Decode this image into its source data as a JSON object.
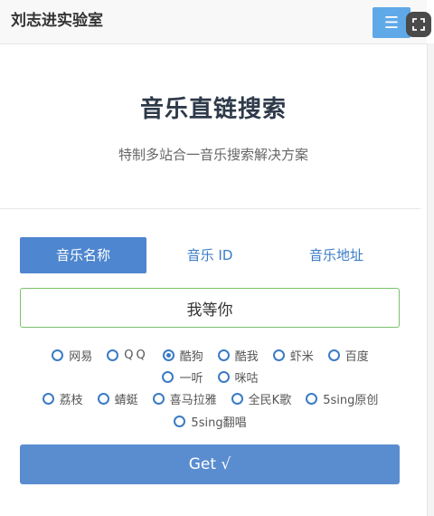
{
  "navbar": {
    "brand": "刘志进实验室",
    "menu_icon": "hamburger-icon",
    "fullscreen_icon": "fullscreen-icon"
  },
  "hero": {
    "title": "音乐直链搜索",
    "subtitle": "特制多站合一音乐搜索解决方案"
  },
  "tabs": [
    {
      "label": "音乐名称",
      "active": true
    },
    {
      "label": "音乐 ID",
      "active": false
    },
    {
      "label": "音乐地址",
      "active": false
    }
  ],
  "search": {
    "value": "我等你"
  },
  "sources": [
    {
      "label": "网易",
      "checked": false
    },
    {
      "label": "QQ",
      "checked": false
    },
    {
      "label": "酷狗",
      "checked": true
    },
    {
      "label": "酷我",
      "checked": false
    },
    {
      "label": "虾米",
      "checked": false
    },
    {
      "label": "百度",
      "checked": false
    },
    {
      "label": "一听",
      "checked": false
    },
    {
      "label": "咪咕",
      "checked": false
    },
    {
      "label": "荔枝",
      "checked": false
    },
    {
      "label": "蜻蜓",
      "checked": false
    },
    {
      "label": "喜马拉雅",
      "checked": false
    },
    {
      "label": "全民K歌",
      "checked": false
    },
    {
      "label": "5sing原创",
      "checked": false
    },
    {
      "label": "5sing翻唱",
      "checked": false
    }
  ],
  "submit": {
    "label": "Get √"
  },
  "colors": {
    "primary": "#4e86cf",
    "button": "#5a8dd0",
    "radio": "#3b7bc4",
    "input_border": "#79c26b"
  }
}
